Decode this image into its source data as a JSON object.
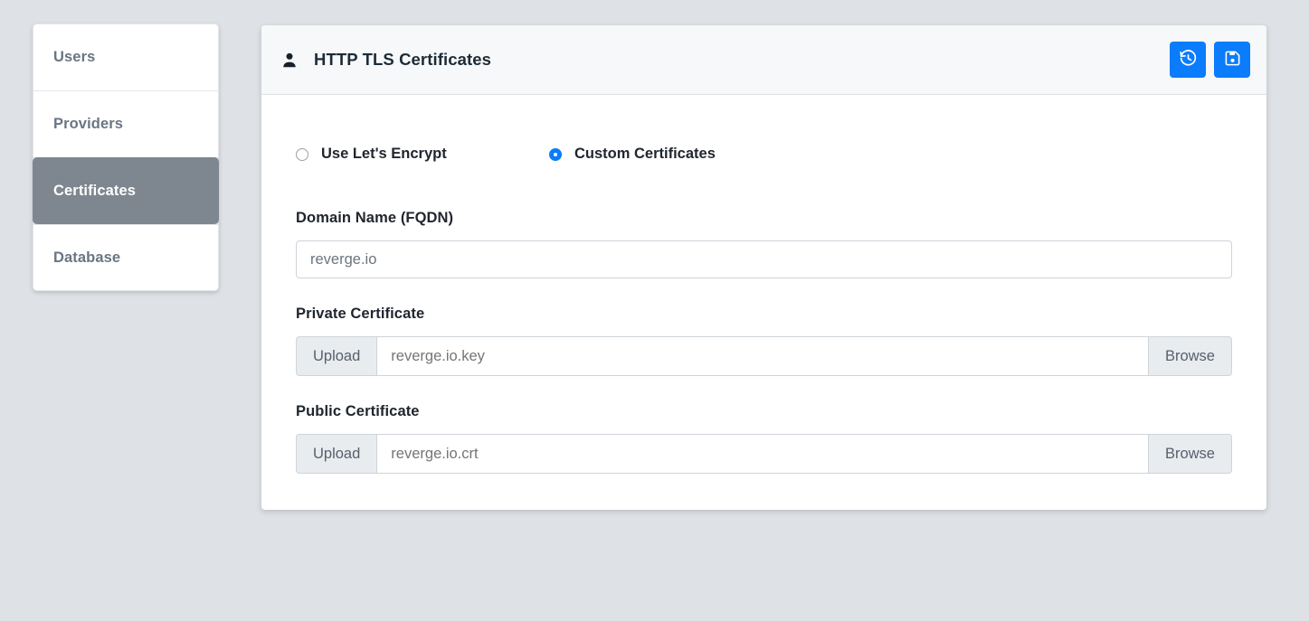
{
  "theme": {
    "page_background": "#dee1e5",
    "accent": "#0b7cfc",
    "active_nav_background": "#7e868f",
    "header_background": "#f7f8f9",
    "input_border": "#ced4da",
    "prepend_background": "#e9ecef"
  },
  "sidebar": {
    "items": [
      {
        "label": "Users",
        "icon": "users-icon",
        "active": false
      },
      {
        "label": "Providers",
        "icon": "providers-icon",
        "active": false
      },
      {
        "label": "Certificates",
        "icon": "certificates-icon",
        "active": true
      },
      {
        "label": "Database",
        "icon": "database-icon",
        "active": false
      }
    ]
  },
  "card": {
    "header": {
      "icon": "user-icon",
      "title": "HTTP TLS Certificates",
      "actions": [
        {
          "icon": "history-restore-icon",
          "name": "restore-button",
          "title": "Restore"
        },
        {
          "icon": "save-floppy-icon",
          "name": "save-button",
          "title": "Save"
        }
      ]
    },
    "mode_options": [
      {
        "label": "Use Let's Encrypt",
        "value": "letsencrypt",
        "selected": false
      },
      {
        "label": "Custom Certificates",
        "value": "custom",
        "selected": true
      }
    ],
    "fields": {
      "domain": {
        "label": "Domain Name (FQDN)",
        "value": "",
        "placeholder": "reverge.io"
      },
      "private_cert": {
        "label": "Private Certificate",
        "upload_label": "Upload",
        "browse_label": "Browse",
        "value": "reverge.io.key",
        "placeholder": "reverge.io.key"
      },
      "public_cert": {
        "label": "Public Certificate",
        "upload_label": "Upload",
        "browse_label": "Browse",
        "value": "reverge.io.crt",
        "placeholder": "reverge.io.crt"
      }
    }
  }
}
